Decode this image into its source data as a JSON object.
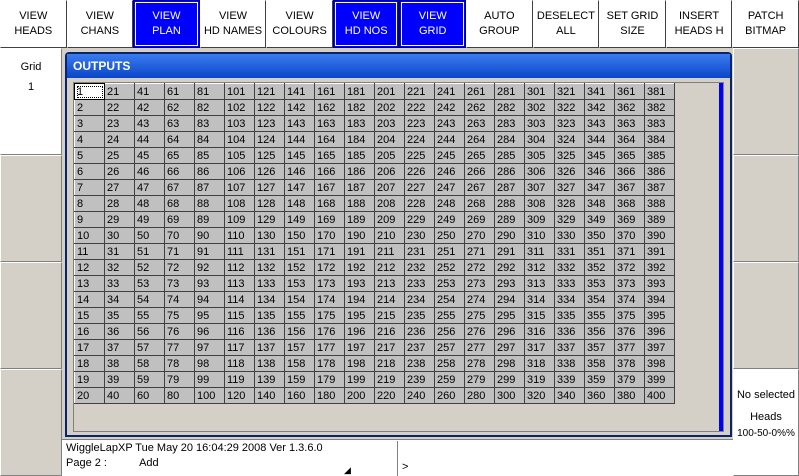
{
  "toolbar": {
    "buttons": [
      {
        "label": "VIEW\nHEADS",
        "active": false
      },
      {
        "label": "VIEW\nCHANS",
        "active": false
      },
      {
        "label": "VIEW\nPLAN",
        "active": true
      },
      {
        "label": "VIEW\nHD NAMES",
        "active": false
      },
      {
        "label": "VIEW\nCOLOURS",
        "active": false
      },
      {
        "label": "VIEW\nHD NOS",
        "active": true
      },
      {
        "label": "VIEW\nGRID",
        "active": true
      },
      {
        "label": "AUTO\nGROUP",
        "active": false
      },
      {
        "label": "DESELECT\nALL",
        "active": false
      },
      {
        "label": "SET GRID\nSIZE",
        "active": false
      },
      {
        "label": "INSERT\nHEADS H",
        "active": false
      },
      {
        "label": "PATCH\nBITMAP",
        "active": false
      }
    ]
  },
  "left_panel": {
    "grid_label": "Grid",
    "grid_value": "1"
  },
  "outputs": {
    "title": "OUTPUTS",
    "rows": 20,
    "cols": 20,
    "selected_cell": "1"
  },
  "right_panel": {
    "status_line1": "No selected",
    "status_line2": "Heads",
    "percent": "100-50-0%%"
  },
  "status": {
    "app_info": "WiggleLapXP   Tue May 20 16:04:29 2008 Ver 1.3.6.0",
    "page_label": "Page 2 :",
    "page_mode": "Add",
    "cmd_prompt": ">"
  },
  "colors": {
    "active_button": "#0000ff",
    "title_bar": "#0a46c8",
    "cell_bg": "#c0c0c0"
  }
}
